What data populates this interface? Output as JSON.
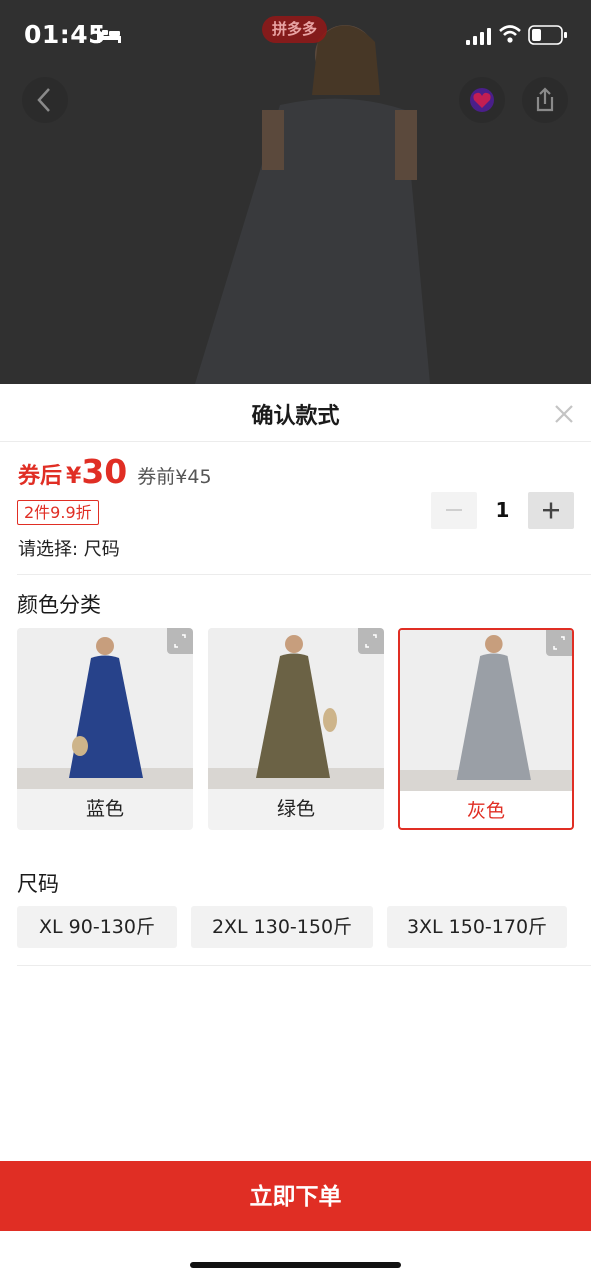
{
  "status_bar": {
    "time": "01:45",
    "icons": [
      "bed-icon",
      "signal-icon",
      "wifi-icon",
      "battery-icon"
    ]
  },
  "header_overlay": {
    "brand_badge": "拼多多",
    "icons": [
      "back-arrow-icon",
      "favorite-icon",
      "share-icon"
    ]
  },
  "sheet": {
    "title": "确认款式",
    "close_icon": "close-icon",
    "price": {
      "prefix": "券后",
      "currency": "¥",
      "value": "30",
      "original": "券前¥45"
    },
    "promo_tag": "2件9.9折",
    "select_hint": "请选择: 尺码",
    "quantity": {
      "value": "1",
      "minus_icon": "minus-icon",
      "plus_icon": "plus-icon"
    },
    "color_section": {
      "label": "颜色分类",
      "options": [
        {
          "name": "蓝色",
          "selected": false,
          "swatch": "#27428a"
        },
        {
          "name": "绿色",
          "selected": false,
          "swatch": "#6b6245"
        },
        {
          "name": "灰色",
          "selected": true,
          "swatch": "#9a9fa6"
        }
      ]
    },
    "size_section": {
      "label": "尺码",
      "options": [
        "XL 90-130斤",
        "2XL 130-150斤",
        "3XL 150-170斤"
      ]
    },
    "order_button": "立即下单"
  },
  "colors": {
    "accent": "#e02e24",
    "chip_bg": "#f2f2f2"
  }
}
